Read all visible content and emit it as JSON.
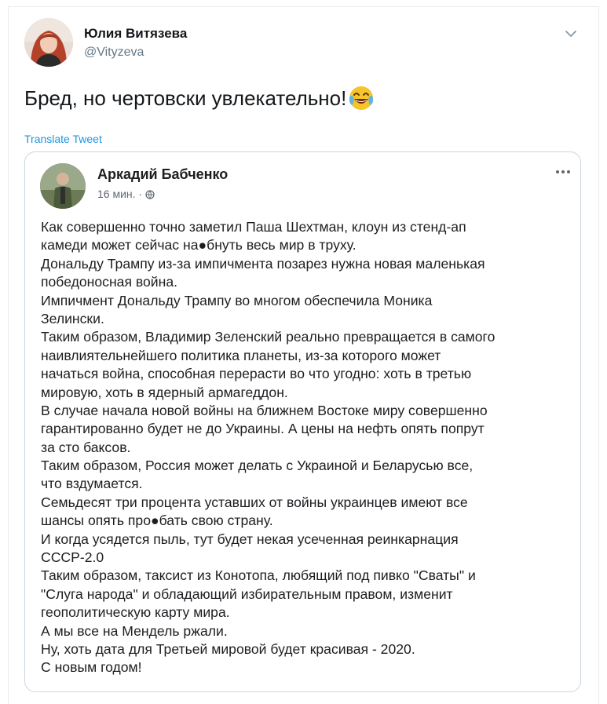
{
  "tweet": {
    "author_name": "Юлия Витязева",
    "author_handle": "@Vityzeva",
    "text": "Бред, но чертовски увлекательно!",
    "emoji": "face-with-tears-of-joy",
    "translate_label": "Translate Tweet"
  },
  "quoted_post": {
    "author_name": "Аркадий Бабченко",
    "time": "16 мин. ·",
    "lines": [
      "Как совершенно точно заметил Паша Шехтман, клоун из стенд-ап",
      "камеди может сейчас на●бнуть весь мир в труху.",
      "Дональду Трампу из-за импичмента позарез нужна новая маленькая",
      "победоносная война.",
      "Импичмент Дональду Трампу во многом обеспечила Моника",
      "Зелински.",
      "Таким образом, Владимир Зеленский реально превращается в самого",
      "наивлиятельнейшего политика планеты, из-за которого может",
      "начаться война, способная перерасти во что угодно: хоть в третью",
      "мировую, хоть в ядерный армагеддон.",
      "В случае начала новой войны на ближнем Востоке миру совершенно",
      "гарантированно будет не до Украины. А цены на нефть опять попрут",
      "за сто баксов.",
      "Таким образом, Россия может делать с Украиной и Беларусью все,",
      "что вздумается.",
      "Семьдесят три процента уставших от войны украинцев имеют все",
      "шансы опять про●бать свою страну.",
      "И когда усядется пыль, тут будет некая усеченная реинкарнация",
      "СССР-2.0",
      "Таким образом, таксист из Конотопа, любящий под пивко \"Сваты\" и",
      "\"Слуга народа\" и обладающий избирательным правом, изменит",
      "геополитическую карту мира.",
      "А мы все на Мендель ржали.",
      "Ну, хоть дата для Третьей мировой будет красивая - 2020.",
      "С новым годом!"
    ]
  },
  "colors": {
    "handle": "#657786",
    "link": "#1b95e0",
    "border": "#ccd6dd",
    "fb_text": "#1c1e21",
    "fb_meta": "#606770"
  }
}
